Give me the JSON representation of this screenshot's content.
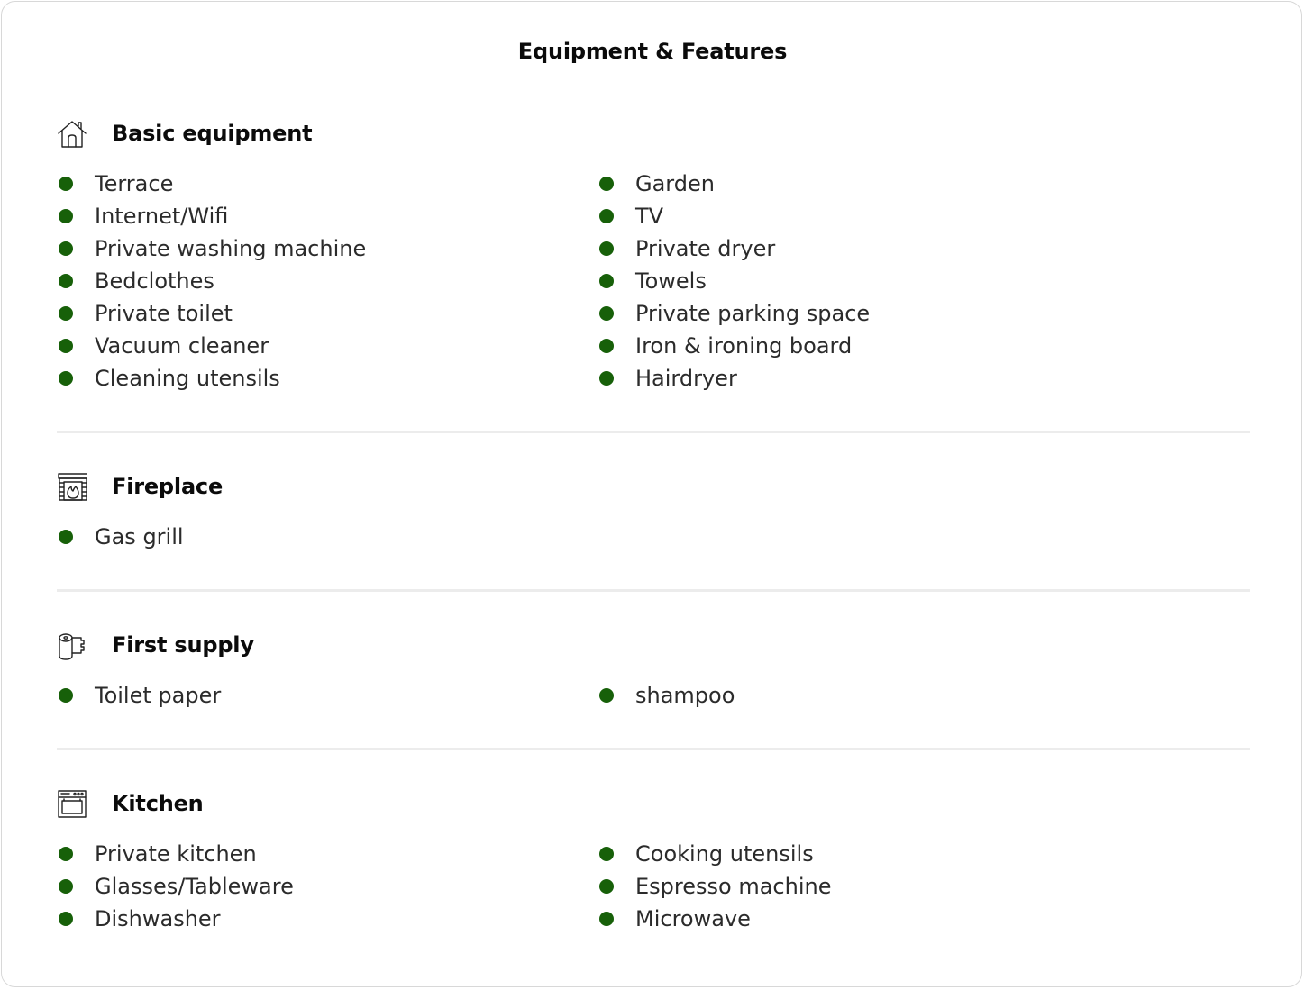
{
  "title": "Equipment & Features",
  "colors": {
    "bullet": "#176009",
    "divider": "#ececec",
    "border": "#d8d8d8"
  },
  "sections": [
    {
      "title": "Basic equipment",
      "icon": "house-icon",
      "items": [
        "Terrace",
        "Internet/Wifi",
        "Private washing machine",
        "Bedclothes",
        "Private toilet",
        "Vacuum cleaner",
        "Cleaning utensils",
        "Garden",
        "TV",
        "Private dryer",
        "Towels",
        "Private parking space",
        "Iron & ironing board",
        "Hairdryer"
      ]
    },
    {
      "title": "Fireplace",
      "icon": "fireplace-icon",
      "items": [
        "Gas grill"
      ]
    },
    {
      "title": "First supply",
      "icon": "toilet-paper-icon",
      "items": [
        "Toilet paper",
        "shampoo"
      ]
    },
    {
      "title": "Kitchen",
      "icon": "oven-icon",
      "items": [
        "Private kitchen",
        "Glasses/Tableware",
        "Dishwasher",
        "Cooking utensils",
        "Espresso machine",
        "Microwave"
      ]
    }
  ]
}
